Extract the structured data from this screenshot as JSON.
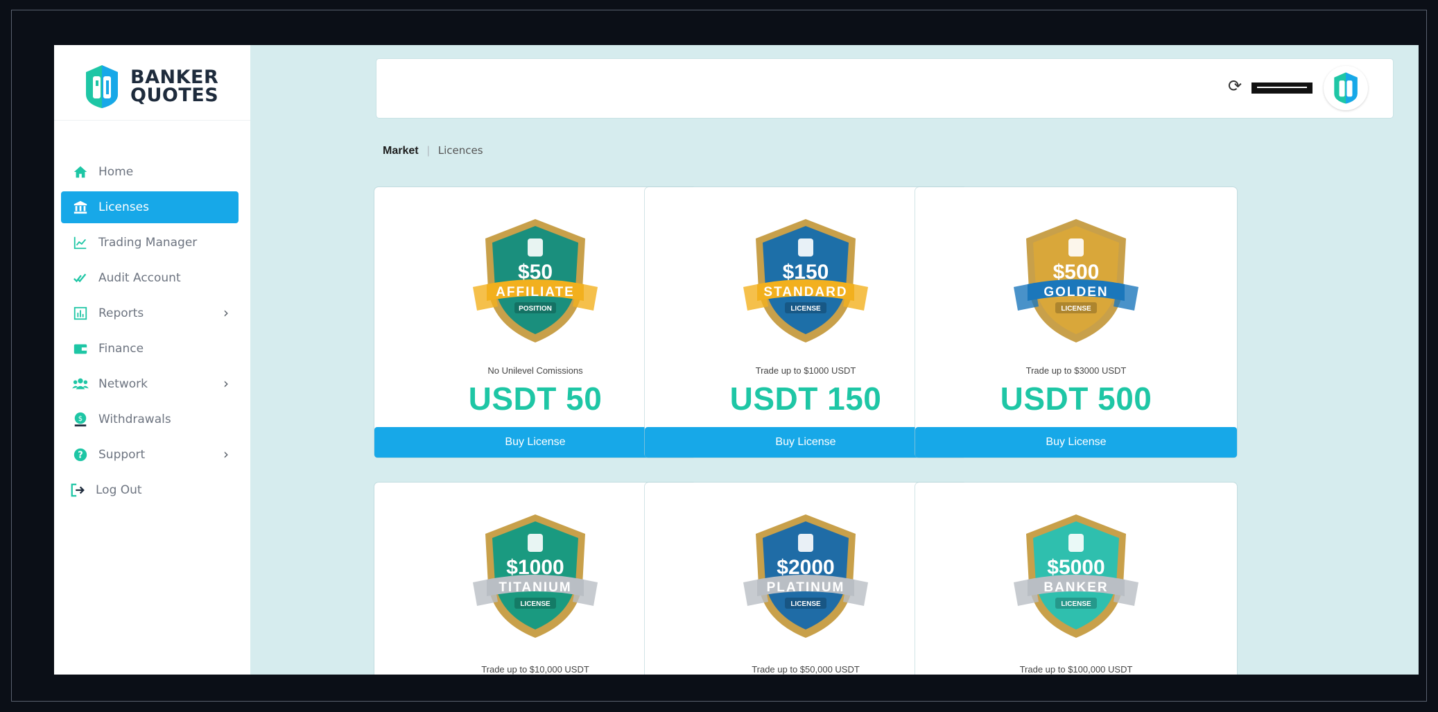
{
  "brand": {
    "line1": "BANKER",
    "line2": "QUOTES",
    "colors": {
      "teal": "#1ec6a5",
      "blue": "#17a8e8",
      "navy": "#1e2b3c"
    }
  },
  "sidebar": {
    "items": [
      {
        "label": "Home",
        "icon": "home-icon",
        "active": false,
        "chevron": false
      },
      {
        "label": "Licenses",
        "icon": "bank-icon",
        "active": true,
        "chevron": false
      },
      {
        "label": "Trading Manager",
        "icon": "chart-line-icon",
        "active": false,
        "chevron": false
      },
      {
        "label": "Audit Account",
        "icon": "double-check-icon",
        "active": false,
        "chevron": false
      },
      {
        "label": "Reports",
        "icon": "bar-chart-icon",
        "active": false,
        "chevron": true
      },
      {
        "label": "Finance",
        "icon": "wallet-icon",
        "active": false,
        "chevron": false
      },
      {
        "label": "Network",
        "icon": "users-icon",
        "active": false,
        "chevron": true
      },
      {
        "label": "Withdrawals",
        "icon": "coin-user-icon",
        "active": false,
        "chevron": false
      },
      {
        "label": "Support",
        "icon": "help-icon",
        "active": false,
        "chevron": true
      },
      {
        "label": "Log Out",
        "icon": "logout-icon",
        "active": false,
        "chevron": false
      }
    ],
    "chevron_glyph": "›"
  },
  "header": {
    "refresh_glyph": "⟳"
  },
  "breadcrumb": {
    "first": "Market",
    "separator": "|",
    "second": "Licences"
  },
  "licenses": [
    {
      "amount": "$50",
      "ribbon": "AFFILIATE",
      "sub": "POSITION",
      "desc": "No Unilevel Comissions",
      "price": "USDT 50",
      "button": "Buy License",
      "shield": "#1a8f7d",
      "ribbonColor": "#f2b01e"
    },
    {
      "amount": "$150",
      "ribbon": "STANDARD",
      "sub": "LICENSE",
      "desc": "Trade up to $1000 USDT",
      "price": "USDT 150",
      "button": "Buy License",
      "shield": "#1d6fa8",
      "ribbonColor": "#f2b01e"
    },
    {
      "amount": "$500",
      "ribbon": "GOLDEN",
      "sub": "LICENSE",
      "desc": "Trade up to $3000 USDT",
      "price": "USDT 500",
      "button": "Buy License",
      "shield": "#d9a73a",
      "ribbonColor": "#1b77bb"
    },
    {
      "amount": "$1000",
      "ribbon": "TITANIUM",
      "sub": "LICENSE",
      "desc": "Trade up to $10,000 USDT",
      "shield": "#1a9a80",
      "ribbonColor": "#b9bec4"
    },
    {
      "amount": "$2000",
      "ribbon": "PLATINUM",
      "sub": "LICENSE",
      "desc": "Trade up to $50,000 USDT",
      "shield": "#1f6ca6",
      "ribbonColor": "#b9bec4"
    },
    {
      "amount": "$5000",
      "ribbon": "BANKER",
      "sub": "LICENSE",
      "desc": "Trade up to $100,000 USDT",
      "shield": "#2fbfae",
      "ribbonColor": "#b9bec4"
    }
  ]
}
